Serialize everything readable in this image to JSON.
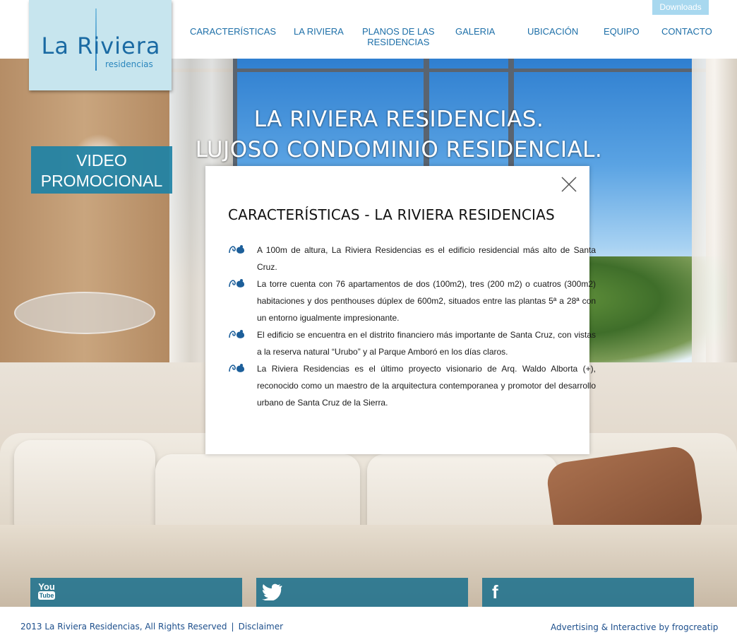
{
  "header": {
    "downloads_label": "Downloads",
    "nav": [
      {
        "label": "CARACTERÍSTICAS"
      },
      {
        "label": "LA RIVIERA"
      },
      {
        "label_line1": "PLANOS DE LAS",
        "label_line2": "RESIDENCIAS"
      },
      {
        "label": "GALERIA"
      },
      {
        "label": "UBICACIÓN"
      },
      {
        "label": "EQUIPO"
      },
      {
        "label": "CONTACTO"
      }
    ]
  },
  "logo": {
    "main": "La Riviera",
    "sub": "residencias",
    "bg_color": "#c7e5ee"
  },
  "hero": {
    "headline_line1": "LA RIVIERA RESIDENCIAS.",
    "headline_line2": "LUJOSO CONDOMINIO RESIDENCIAL.",
    "video_line1": "VIDEO",
    "video_line2": "PROMOCIONAL"
  },
  "modal": {
    "title": "CARACTERÍSTICAS - LA RIVIERA RESIDENCIAS",
    "close_icon": "close-icon",
    "features": [
      "A 100m de altura, La Riviera Residencias es el edificio residencial más alto de Santa Cruz.",
      "La torre cuenta con 76 apartamentos de dos (100m2), tres (200 m2) o cuatros (300m2) habitaciones y dos penthouses dúplex de 600m2, situados entre las plantas 5ª a 28ª con un entorno igualmente impresionante.",
      "El edificio se encuentra en el distrito financiero más importante de Santa Cruz, con vistas a la reserva natural “Urubo” y al Parque Amboró en los días claros.",
      "La Riviera Residencias es el último proyecto visionario de Arq. Waldo Alborta (+), reconocido como un maestro de la arquitectura contemporanea y promotor del desarrollo urbano de Santa Cruz de la Sierra."
    ],
    "feature_icon": "bullet-swirl-icon"
  },
  "social": [
    {
      "icon": "youtube-icon",
      "label_top": "You",
      "label_bottom": "Tube"
    },
    {
      "icon": "twitter-icon"
    },
    {
      "icon": "facebook-icon",
      "label": "f"
    }
  ],
  "footer": {
    "copyright": "2013 La Riviera Residencias, All Rights Reserved",
    "separator": "|",
    "disclaimer": "Disclaimer",
    "credit": "Advertising & Interactive by frogcreatip"
  },
  "colors": {
    "nav_text": "#1d6fa8",
    "accent_teal": "#1e82a5",
    "downloads_bg": "#a8d8ef",
    "footer_text": "#1d4f8c"
  }
}
